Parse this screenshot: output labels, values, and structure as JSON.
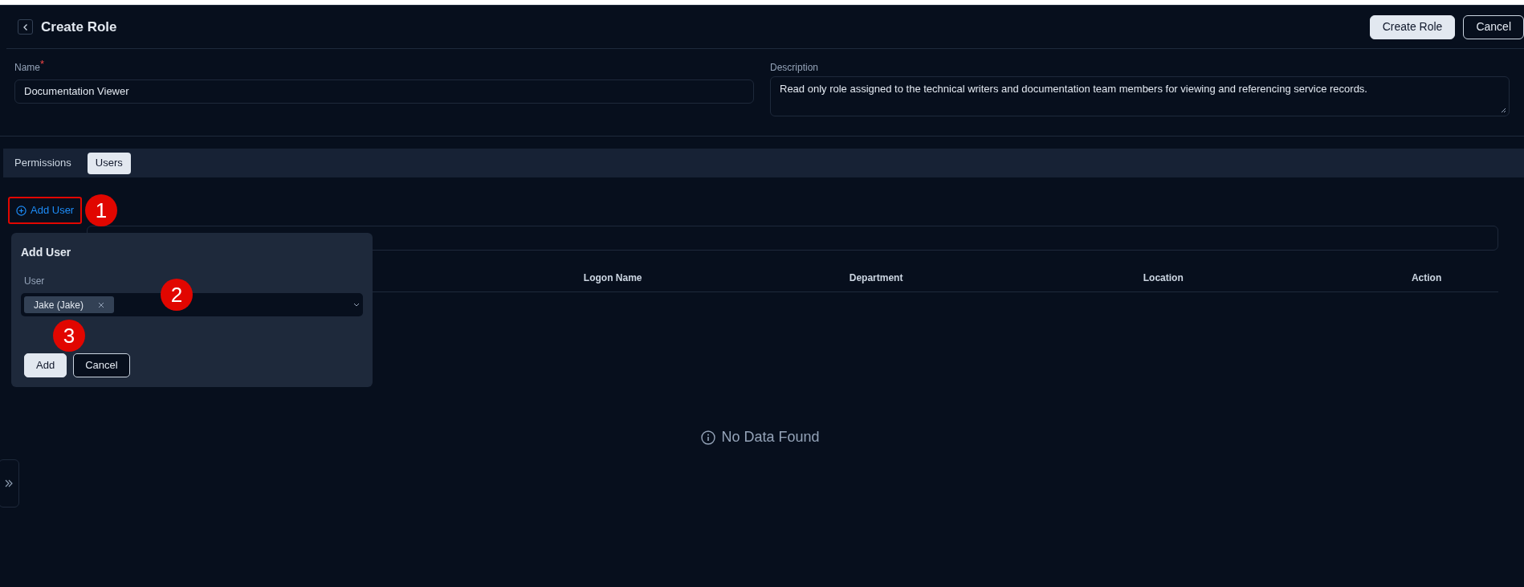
{
  "header": {
    "title": "Create Role",
    "buttons": [
      {
        "label": "Create Role",
        "kind": "primary"
      },
      {
        "label": "Cancel",
        "kind": "outline"
      }
    ]
  },
  "form": {
    "name": {
      "label": "Name",
      "required_mark": "*",
      "value": "Documentation Viewer"
    },
    "description": {
      "label": "Description",
      "value": "Read only role assigned to the technical writers and documentation team members for viewing and referencing service records."
    }
  },
  "tabs": [
    {
      "label": "Permissions",
      "selected": false
    },
    {
      "label": "Users",
      "selected": true
    }
  ],
  "add_user_link": "Add User",
  "table": {
    "columns": [
      "Logon Name",
      "Department",
      "Location",
      "Action"
    ],
    "empty_text": "No Data Found"
  },
  "popover": {
    "title": "Add User",
    "field_label": "User",
    "chips": [
      "Jake (Jake)"
    ],
    "buttons": [
      {
        "label": "Add",
        "kind": "primary"
      },
      {
        "label": "Cancel",
        "kind": "outline"
      }
    ]
  },
  "annotations": [
    "1",
    "2",
    "3"
  ]
}
